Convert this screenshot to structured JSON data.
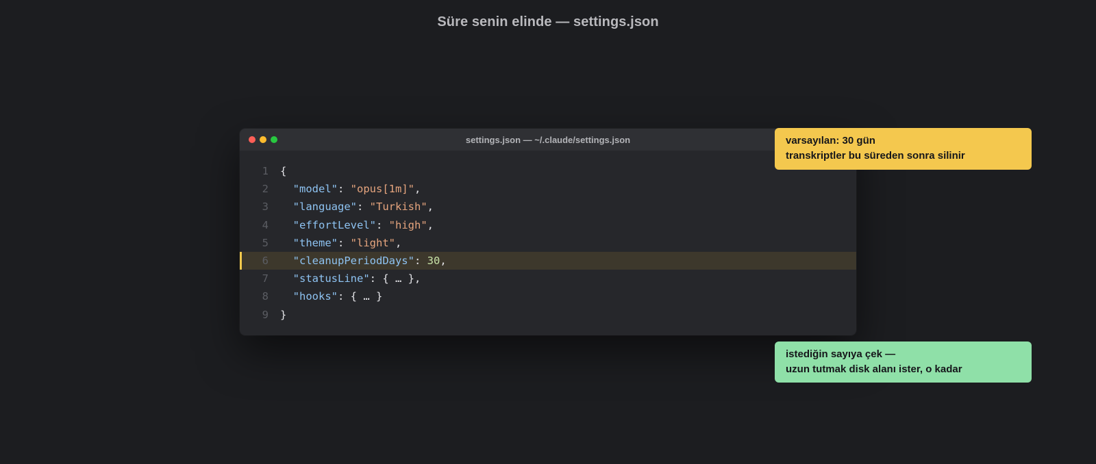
{
  "page": {
    "title": "Süre senin elinde — settings.json"
  },
  "window": {
    "title": "settings.json — ~/.claude/settings.json",
    "controls": [
      "close",
      "minimize",
      "maximize"
    ]
  },
  "code": {
    "highlighted_line": 6,
    "lines": [
      {
        "number": "1",
        "parts": [
          {
            "t": "p",
            "v": "{"
          }
        ]
      },
      {
        "number": "2",
        "parts": [
          {
            "t": "p",
            "v": "  "
          },
          {
            "t": "k",
            "v": "\"model\""
          },
          {
            "t": "p",
            "v": ": "
          },
          {
            "t": "s",
            "v": "\"opus[1m]\""
          },
          {
            "t": "p",
            "v": ","
          }
        ]
      },
      {
        "number": "3",
        "parts": [
          {
            "t": "p",
            "v": "  "
          },
          {
            "t": "k",
            "v": "\"language\""
          },
          {
            "t": "p",
            "v": ": "
          },
          {
            "t": "s",
            "v": "\"Turkish\""
          },
          {
            "t": "p",
            "v": ","
          }
        ]
      },
      {
        "number": "4",
        "parts": [
          {
            "t": "p",
            "v": "  "
          },
          {
            "t": "k",
            "v": "\"effortLevel\""
          },
          {
            "t": "p",
            "v": ": "
          },
          {
            "t": "s",
            "v": "\"high\""
          },
          {
            "t": "p",
            "v": ","
          }
        ]
      },
      {
        "number": "5",
        "parts": [
          {
            "t": "p",
            "v": "  "
          },
          {
            "t": "k",
            "v": "\"theme\""
          },
          {
            "t": "p",
            "v": ": "
          },
          {
            "t": "s",
            "v": "\"light\""
          },
          {
            "t": "p",
            "v": ","
          }
        ]
      },
      {
        "number": "6",
        "parts": [
          {
            "t": "p",
            "v": "  "
          },
          {
            "t": "k",
            "v": "\"cleanupPeriodDays\""
          },
          {
            "t": "p",
            "v": ": "
          },
          {
            "t": "n",
            "v": "30"
          },
          {
            "t": "p",
            "v": ","
          }
        ]
      },
      {
        "number": "7",
        "parts": [
          {
            "t": "p",
            "v": "  "
          },
          {
            "t": "k",
            "v": "\"statusLine\""
          },
          {
            "t": "p",
            "v": ": { … },"
          }
        ]
      },
      {
        "number": "8",
        "parts": [
          {
            "t": "p",
            "v": "  "
          },
          {
            "t": "k",
            "v": "\"hooks\""
          },
          {
            "t": "p",
            "v": ": { … }"
          }
        ]
      },
      {
        "number": "9",
        "parts": [
          {
            "t": "p",
            "v": "}"
          }
        ]
      }
    ]
  },
  "notes": {
    "default": {
      "line1": "varsayılan: 30 gün",
      "line2": "transkriptler bu süreden sonra silinir"
    },
    "advice": {
      "line1": "istediğin sayıya çek —",
      "line2": "uzun tutmak disk alanı ister, o kadar"
    }
  },
  "colors": {
    "background": "#1c1d20",
    "editor": "#26272b",
    "highlight": "#3d382c",
    "note_yellow": "#f4c84e",
    "note_green": "#8fe0a8"
  }
}
